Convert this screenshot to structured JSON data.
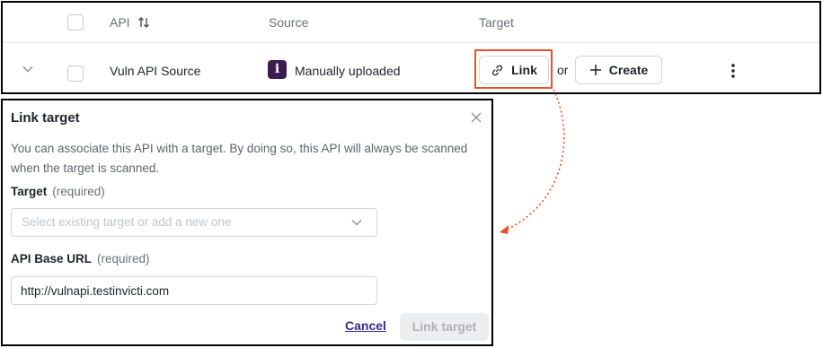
{
  "table": {
    "columns": {
      "api": "API",
      "source": "Source",
      "target": "Target"
    },
    "row": {
      "api_name": "Vuln API Source",
      "source_badge": "i",
      "source_label": "Manually uploaded",
      "link_label": "Link",
      "or_text": "or",
      "create_label": "Create"
    }
  },
  "panel": {
    "title": "Link target",
    "description": "You can associate this API with a target. By doing so, this API will always be scanned when the target is scanned.",
    "target_label": "Target",
    "target_required": "(required)",
    "target_placeholder": "Select existing target or add a new one",
    "url_label": "API Base URL",
    "url_required": "(required)",
    "url_value": "http://vulnapi.testinvicti.com",
    "cancel_label": "Cancel",
    "submit_label": "Link target"
  },
  "colors": {
    "highlight": "#e8522a",
    "badge": "#3a1c4e",
    "cancel_link": "#3b2a8f"
  },
  "icons": [
    "sort-icon",
    "chevron-down-icon",
    "source-icon",
    "link-icon",
    "plus-icon",
    "kebab-menu-icon",
    "close-icon"
  ]
}
